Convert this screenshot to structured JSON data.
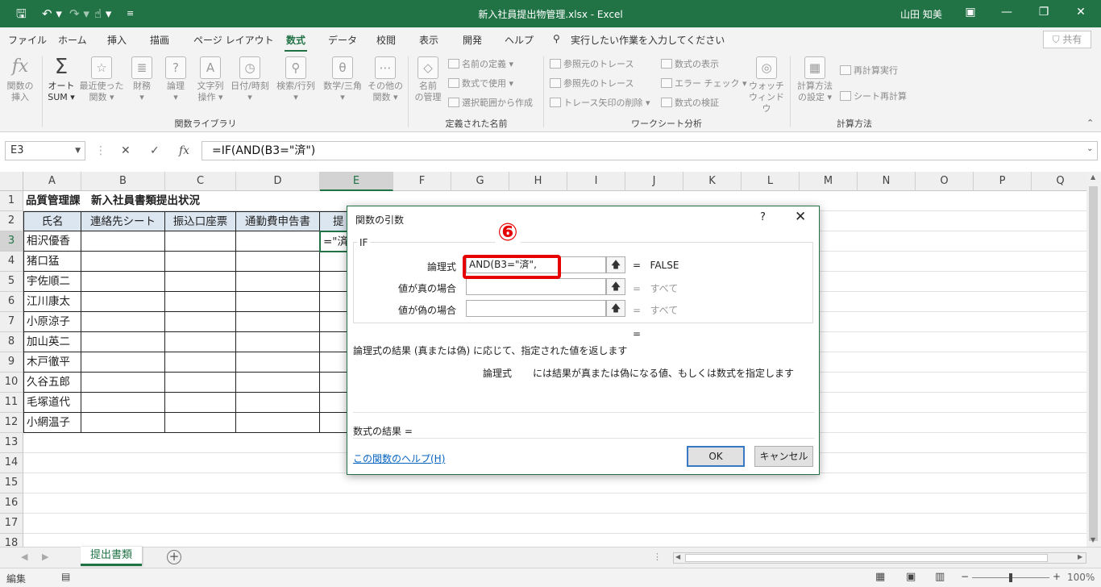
{
  "window": {
    "title": "新入社員提出物管理.xlsx  -  Excel",
    "user": "山田 知美"
  },
  "menu": {
    "items": [
      "ファイル",
      "ホーム",
      "挿入",
      "描画",
      "ページ レイアウト",
      "数式",
      "データ",
      "校閲",
      "表示",
      "開発",
      "ヘルプ"
    ],
    "tell_me": "実行したい作業を入力してください",
    "share": "共有"
  },
  "ribbon": {
    "insert_function": [
      "関数の",
      "挿入"
    ],
    "autosum": [
      "オート",
      "SUM ▾"
    ],
    "recent": [
      "最近使った",
      "関数 ▾"
    ],
    "financial": [
      "財務",
      "▾"
    ],
    "logical": [
      "論理",
      "▾"
    ],
    "text": [
      "文字列",
      "操作 ▾"
    ],
    "datetime": [
      "日付/時刻",
      "▾"
    ],
    "lookup": [
      "検索/行列",
      "▾"
    ],
    "math": [
      "数学/三角",
      "▾"
    ],
    "more": [
      "その他の",
      "関数 ▾"
    ],
    "name_manager": [
      "名前",
      "の管理"
    ],
    "define_name": "名前の定義 ▾",
    "use_in_formula": "数式で使用 ▾",
    "create_from_selection": "選択範囲から作成",
    "trace_precedents": "参照元のトレース",
    "trace_dependents": "参照先のトレース",
    "remove_arrows": "トレース矢印の削除 ▾",
    "show_formulas": "数式の表示",
    "error_checking": "エラー チェック ▾",
    "evaluate_formula": "数式の検証",
    "watch_window": [
      "ウォッチ",
      "ウィンドウ"
    ],
    "calc_options": [
      "計算方法",
      "の設定 ▾"
    ],
    "calc_now": "再計算実行",
    "calc_sheet": "シート再計算",
    "groups": [
      "関数ライブラリ",
      "定義された名前",
      "ワークシート分析",
      "計算方法"
    ]
  },
  "formula_bar": {
    "name_box": "E3",
    "formula": "=IF(AND(B3=\"済\")"
  },
  "sheet": {
    "columns": [
      "A",
      "B",
      "C",
      "D",
      "E",
      "F",
      "G",
      "H",
      "I",
      "J",
      "K",
      "L",
      "M",
      "N",
      "O",
      "P",
      "Q"
    ],
    "rows": [
      "1",
      "2",
      "3",
      "4",
      "5",
      "6",
      "7",
      "8",
      "9",
      "10",
      "11",
      "12",
      "13",
      "14",
      "15",
      "16",
      "17",
      "18"
    ],
    "title": "品質管理課　新入社員書類提出状況",
    "headers": [
      "氏名",
      "連絡先シート",
      "振込口座票",
      "通勤費申告書",
      "提"
    ],
    "names": [
      "相沢優香",
      "猪口猛",
      "宇佐順二",
      "江川康太",
      "小原涼子",
      "加山英二",
      "木戸徹平",
      "久谷五郎",
      "毛塚道代",
      "小網温子"
    ],
    "e3": "=\"済\""
  },
  "dialog": {
    "title": "関数の引数",
    "help_q": "?",
    "function": "IF",
    "marker": "⑥",
    "args": [
      {
        "label": "論理式",
        "value": "AND(B3=\"済\",",
        "result": "FALSE"
      },
      {
        "label": "値が真の場合",
        "value": "",
        "result": "すべて"
      },
      {
        "label": "値が偽の場合",
        "value": "",
        "result": "すべて"
      }
    ],
    "eq": "=",
    "description": "論理式の結果 (真または偽) に応じて、指定された値を返します",
    "arg_help_label": "論理式",
    "arg_help": "には結果が真または偽になる値、もしくは数式を指定します",
    "formula_result": "数式の結果 =",
    "help_link": "この関数のヘルプ(H)",
    "ok": "OK",
    "cancel": "キャンセル"
  },
  "tabs": {
    "sheet_name": "提出書類"
  },
  "status": {
    "mode": "編集",
    "zoom": "100%"
  }
}
